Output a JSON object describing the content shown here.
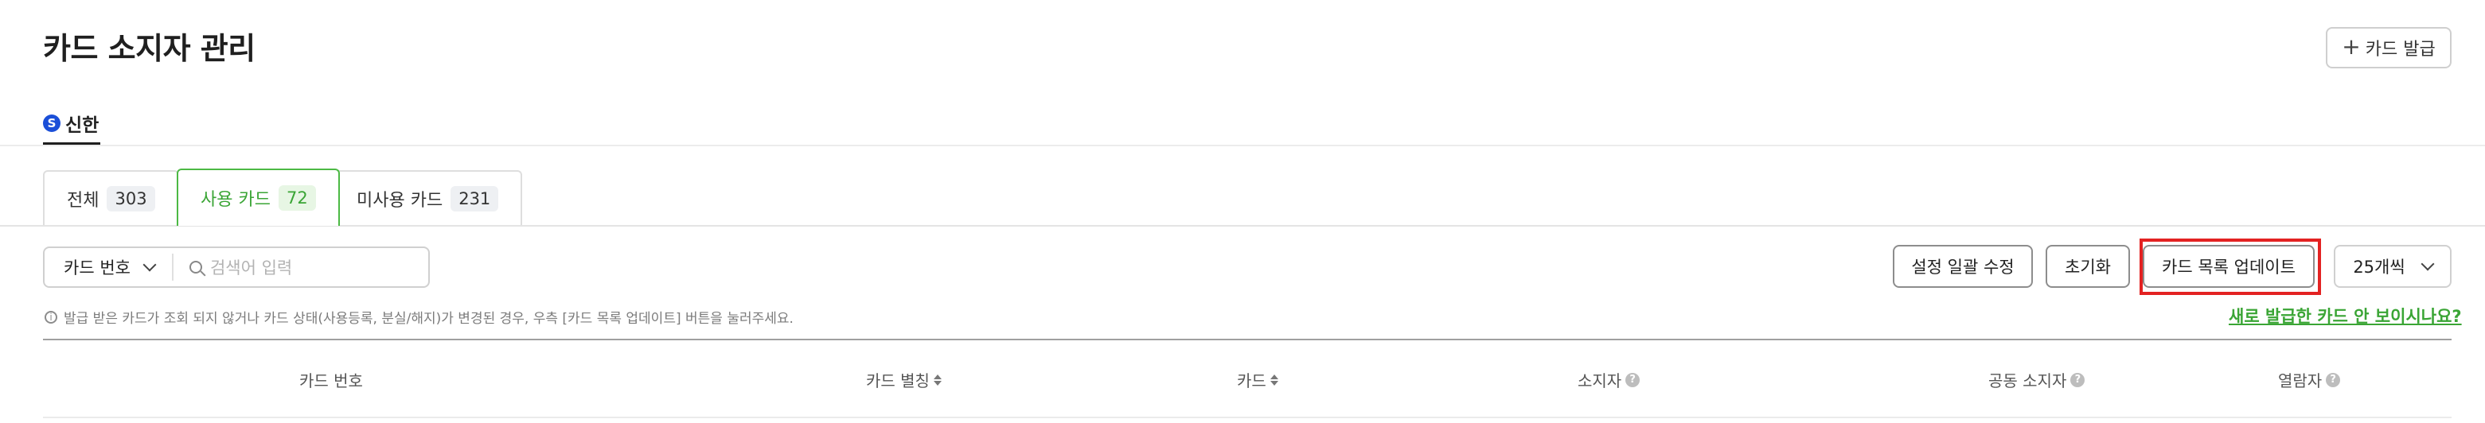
{
  "header": {
    "title": "카드 소지자 관리",
    "issue_button": "카드 발급"
  },
  "bank": {
    "label": "신한",
    "logo_letter": "S",
    "logo_color": "#1b4fd8"
  },
  "tabs": [
    {
      "label": "전체",
      "count": "303",
      "active": false
    },
    {
      "label": "사용 카드",
      "count": "72",
      "active": true
    },
    {
      "label": "미사용 카드",
      "count": "231",
      "active": false
    }
  ],
  "filters": {
    "select_value": "카드 번호",
    "search_placeholder": "검색어 입력"
  },
  "actions": {
    "bulk_edit": "설정 일괄 수정",
    "reset": "초기화",
    "update_list": "카드 목록 업데이트",
    "per_page": "25개씩"
  },
  "info": {
    "text": "발급 받은 카드가 조회 되지 않거나 카드 상태(사용등록, 분실/해지)가 변경된 경우, 우측 [카드 목록 업데이트] 버튼을 눌러주세요.",
    "link": "새로 발급한 카드 안 보이시나요?"
  },
  "table": {
    "columns": {
      "card_number": "카드 번호",
      "card_alias": "카드 별칭",
      "card": "카드",
      "holder": "소지자",
      "co_holder": "공동 소지자",
      "viewer": "열람자"
    }
  },
  "colors": {
    "accent_green": "#3aa535",
    "highlight_red": "#e32222"
  }
}
